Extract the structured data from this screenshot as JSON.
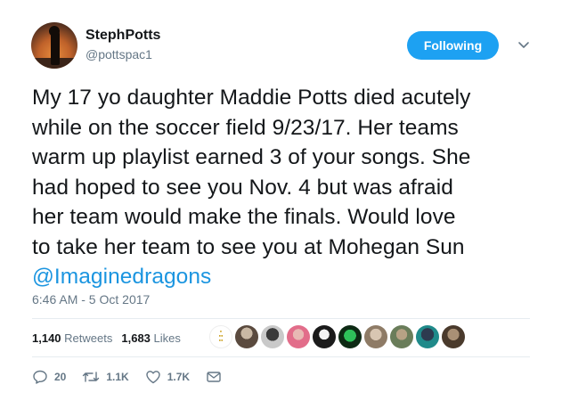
{
  "user": {
    "name": "StephPotts",
    "handle": "@pottspac1"
  },
  "follow_button": {
    "label": "Following"
  },
  "tweet": {
    "lines": [
      "My 17 yo daughter Maddie Potts died acutely",
      "while on the soccer field 9/23/17. Her teams",
      "warm up playlist earned 3 of your songs. She",
      "had hoped to see you Nov. 4 but was afraid",
      "her team would make the finals. Would love",
      "to take her team to see you at Mohegan Sun"
    ],
    "mention": "@Imaginedragons",
    "timestamp": "6:46 AM - 5 Oct 2017"
  },
  "stats": {
    "retweets_count": "1,140",
    "retweets_label": "Retweets",
    "likes_count": "1,683",
    "likes_label": "Likes"
  },
  "actions": {
    "replies": "20",
    "retweets": "1.1K",
    "likes": "1.7K"
  },
  "liker_avatars": [
    {
      "name": "text-graphic"
    },
    {
      "name": "person"
    },
    {
      "name": "person"
    },
    {
      "name": "person"
    },
    {
      "name": "person"
    },
    {
      "name": "person"
    },
    {
      "name": "person"
    },
    {
      "name": "person"
    },
    {
      "name": "person"
    },
    {
      "name": "person"
    }
  ],
  "colors": {
    "accent": "#1da1f2",
    "link": "#1b95e0",
    "muted": "#657786",
    "text": "#14171a"
  }
}
